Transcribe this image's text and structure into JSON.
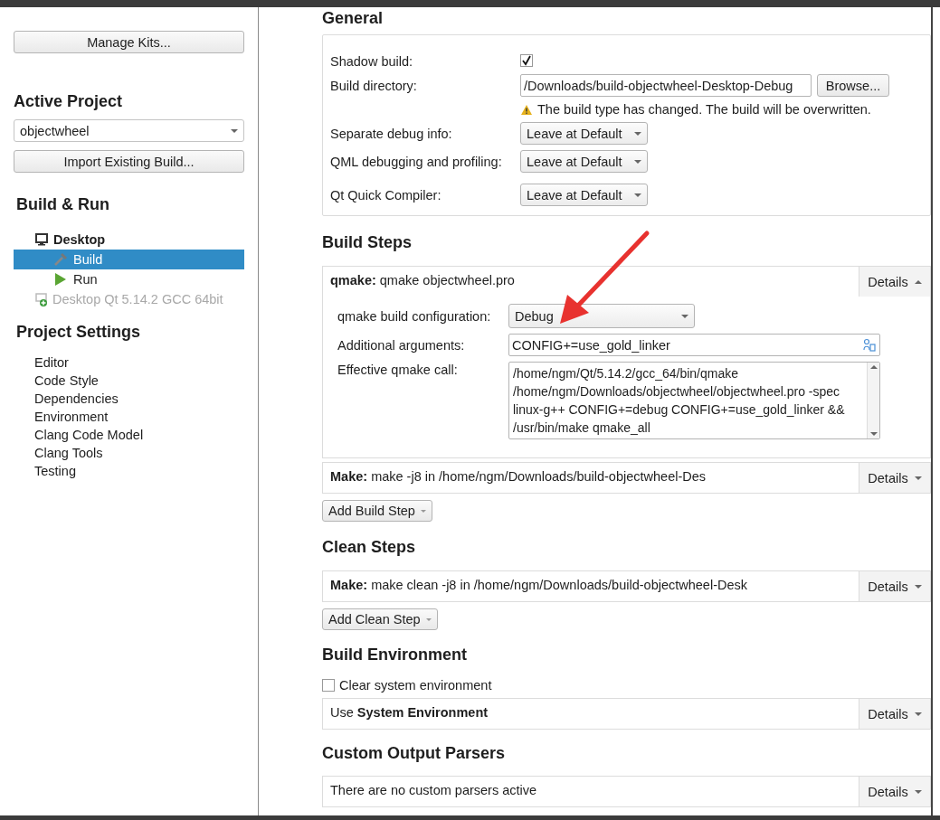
{
  "sidebar": {
    "manage_kits_button": "Manage Kits...",
    "active_project": {
      "title": "Active Project",
      "value": "objectwheel",
      "import_button": "Import Existing Build..."
    },
    "build_run": {
      "title": "Build & Run",
      "kits": [
        {
          "label": "Desktop",
          "kind": "kit",
          "enabled": true,
          "children": [
            {
              "label": "Build",
              "kind": "build",
              "selected": true
            },
            {
              "label": "Run",
              "kind": "run",
              "selected": false
            }
          ]
        },
        {
          "label": "Desktop Qt 5.14.2 GCC 64bit",
          "kind": "kit",
          "enabled": false
        }
      ]
    },
    "project_settings": {
      "title": "Project Settings",
      "items": [
        "Editor",
        "Code Style",
        "Dependencies",
        "Environment",
        "Clang Code Model",
        "Clang Tools",
        "Testing"
      ]
    }
  },
  "general": {
    "title": "General",
    "shadow_build": {
      "label": "Shadow build:",
      "checked": true
    },
    "build_directory": {
      "label": "Build directory:",
      "value": "/Downloads/build-objectwheel-Desktop-Debug",
      "browse_button": "Browse..."
    },
    "warning": "The build type has changed. The build will be overwritten.",
    "options": [
      {
        "label": "Separate debug info:",
        "value": "Leave at Default"
      },
      {
        "label": "QML debugging and profiling:",
        "value": "Leave at Default"
      },
      {
        "label": "Qt Quick Compiler:",
        "value": "Leave at Default"
      }
    ]
  },
  "build_steps": {
    "title": "Build Steps",
    "steps": [
      {
        "summary": "**qmake:** qmake objectwheel.pro",
        "details_button": "Details",
        "expanded": true,
        "config": {
          "configuration": {
            "label": "qmake build configuration:",
            "value": "Debug"
          },
          "arguments": {
            "label": "Additional arguments:",
            "value": "CONFIG+=use_gold_linker"
          },
          "call": {
            "label": "Effective qmake call:",
            "value": "/home/ngm/Qt/5.14.2/gcc_64/bin/qmake /home/ngm/Downloads/objectwheel/objectwheel.pro -spec linux-g++ CONFIG+=debug CONFIG+=use_gold_linker && /usr/bin/make qmake_all"
          }
        }
      },
      {
        "summary": "**Make:** make -j8 in /home/ngm/Downloads/build-objectwheel-Des",
        "details_button": "Details",
        "expanded": false
      }
    ],
    "add_button": "Add Build Step"
  },
  "clean_steps": {
    "title": "Clean Steps",
    "steps": [
      {
        "summary": "**Make:** make clean -j8 in /home/ngm/Downloads/build-objectwheel-Desk",
        "details_button": "Details",
        "expanded": false
      }
    ],
    "add_button": "Add Clean Step"
  },
  "build_environment": {
    "title": "Build Environment",
    "clear_system": {
      "label": "Clear system environment",
      "checked": false
    },
    "summary": "Use **System Environment**",
    "details_button": "Details",
    "expanded": false
  },
  "custom_output_parsers": {
    "title": "Custom Output Parsers",
    "summary": "There are no custom parsers active",
    "details_button": "Details",
    "expanded": false
  }
}
